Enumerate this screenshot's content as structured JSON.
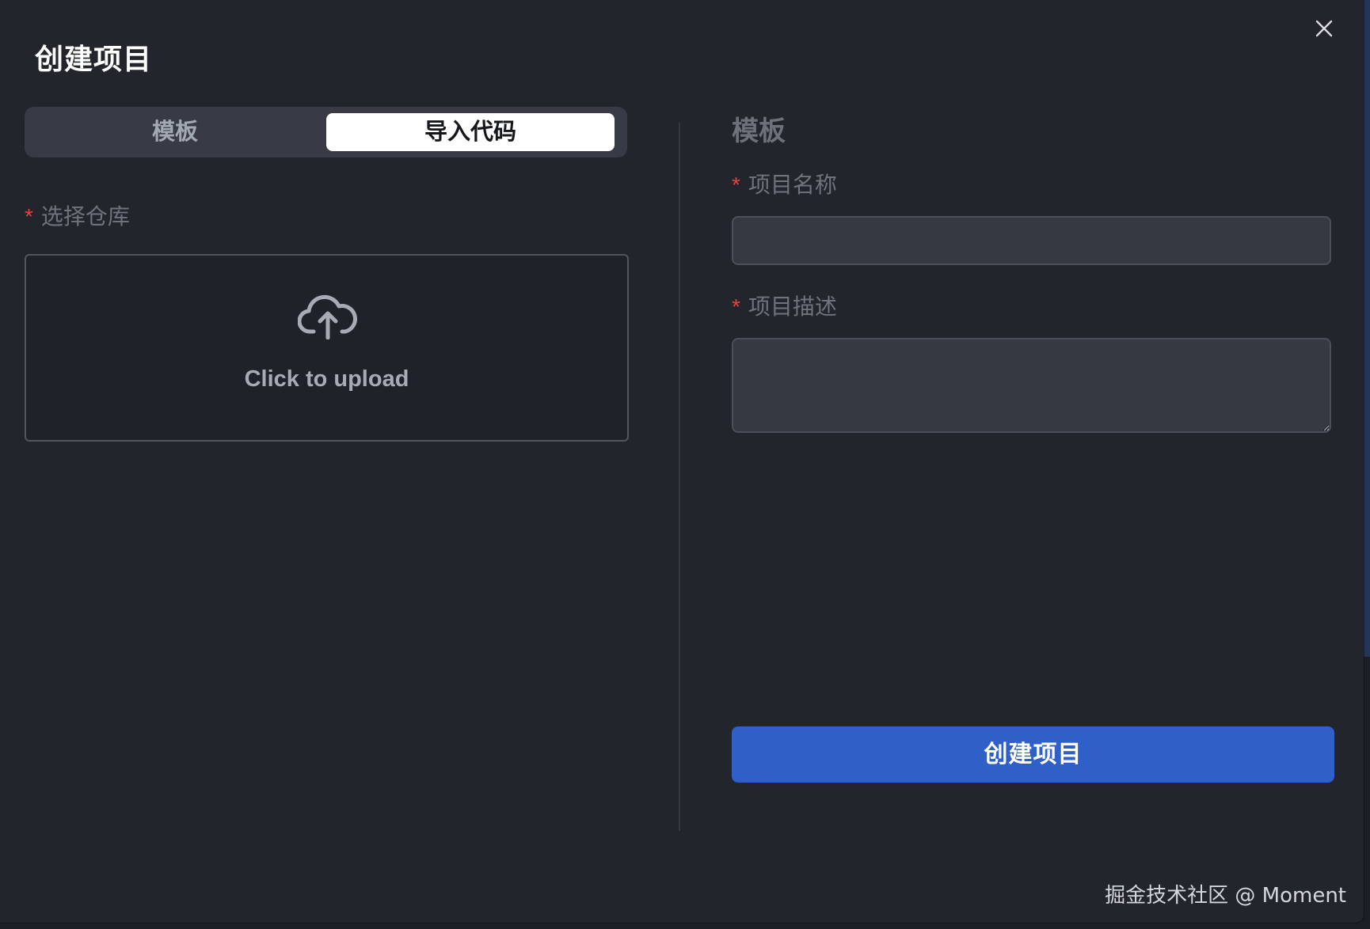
{
  "dialog": {
    "title": "创建项目",
    "close_icon": "close-icon"
  },
  "tabs": [
    {
      "label": "模板",
      "active": false
    },
    {
      "label": "导入代码",
      "active": true
    }
  ],
  "repo_field": {
    "label": "选择仓库",
    "required_mark": "*"
  },
  "upload": {
    "icon": "cloud-upload-icon",
    "label": "Click to upload"
  },
  "form": {
    "section_title": "模板",
    "name_label": "项目名称",
    "name_value": "",
    "desc_label": "项目描述",
    "desc_value": "",
    "required_mark": "*",
    "submit_label": "创建项目"
  },
  "watermark": "掘金技术社区 @ Moment",
  "colors": {
    "dialog_bg": "#22252b",
    "primary": "#2f60c8",
    "required": "#e3433f"
  }
}
